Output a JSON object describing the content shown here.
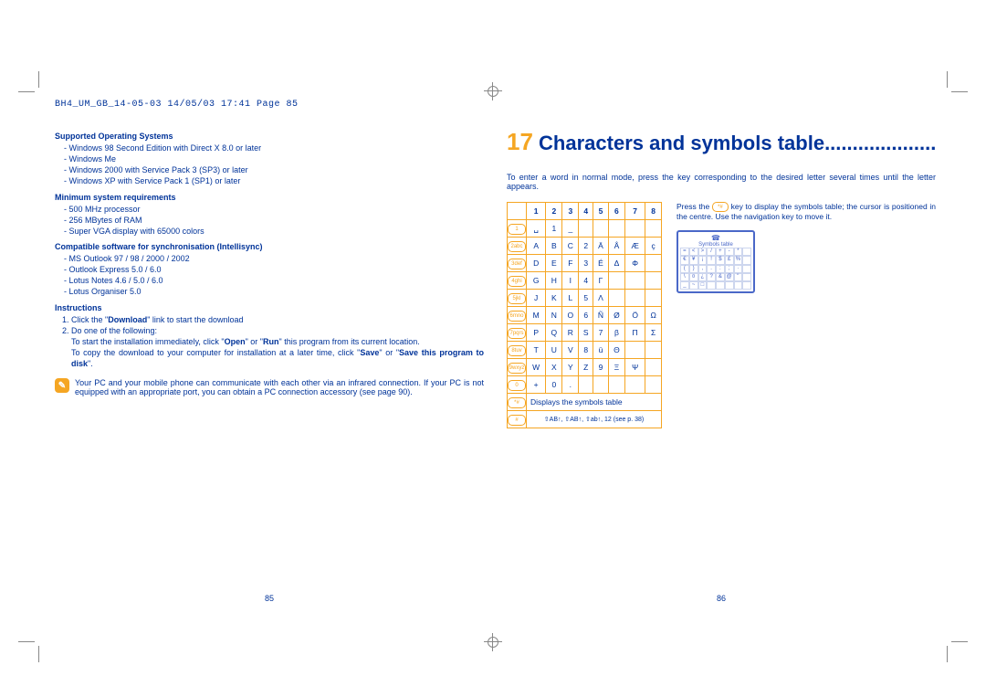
{
  "header_strip": "BH4_UM_GB_14-05-03  14/05/03  17:41  Page 85",
  "left": {
    "h_os": "Supported Operating Systems",
    "os": [
      "Windows 98 Second Edition with Direct X 8.0 or later",
      "Windows Me",
      "Windows 2000 with Service Pack 3 (SP3) or later",
      "Windows XP with Service Pack 1 (SP1) or later"
    ],
    "h_req": "Minimum system requirements",
    "req": [
      "500 MHz processor",
      "256 MBytes of RAM",
      "Super VGA display with 65000 colors"
    ],
    "h_sw": "Compatible software for synchronisation (Intellisync)",
    "sw": [
      "MS Outlook 97 / 98 / 2000 / 2002",
      "Outlook Express 5.0 / 6.0",
      "Lotus Notes 4.6 / 5.0 / 6.0",
      "Lotus Organiser 5.0"
    ],
    "h_inst": "Instructions",
    "inst1_a": "Click the \"",
    "inst1_b": "Download",
    "inst1_c": "\" link to start the download",
    "inst2": "Do one of the following:",
    "inst_sub_a": "To start the installation immediately, click \"",
    "inst_sub_b": "Open",
    "inst_sub_c": "\" or \"",
    "inst_sub_d": "Run",
    "inst_sub_e": "\" this program from its current location.",
    "inst_sub2_a": "To copy the download to your computer for installation at a later time, click \"",
    "inst_sub2_b": "Save",
    "inst_sub2_c": "\" or \"",
    "inst_sub2_d": "Save this program to disk",
    "inst_sub2_e": "\".",
    "note": "Your PC and your mobile phone can communicate with each other via an infrared connection. If your PC is not equipped with an appropriate port, you can obtain a PC connection accessory (see page 90).",
    "pgnum": "85"
  },
  "right": {
    "chapter_num": "17",
    "chapter_title": "Characters and symbols table",
    "chapter_dots": "....................",
    "intro": "To enter a word in normal mode, press the key corresponding to the desired letter several times until the letter appears.",
    "side_a": "Press the ",
    "side_b": " key to display the symbols table; the cursor is positioned in the centre. Use the navigation key to move it.",
    "table": {
      "head": [
        "",
        "1",
        "2",
        "3",
        "4",
        "5",
        "6",
        "7",
        "8"
      ],
      "rows": [
        {
          "key": "1",
          "cells": [
            "␣",
            "1",
            "_",
            "",
            "",
            "",
            "",
            ""
          ]
        },
        {
          "key": "2abc",
          "cells": [
            "A",
            "B",
            "C",
            "2",
            "Ä",
            "Å",
            "Æ",
            "ç"
          ]
        },
        {
          "key": "3def",
          "cells": [
            "D",
            "E",
            "F",
            "3",
            "É",
            "Δ",
            "Φ",
            ""
          ]
        },
        {
          "key": "4ghi",
          "cells": [
            "G",
            "H",
            "I",
            "4",
            "Γ",
            "",
            "",
            ""
          ]
        },
        {
          "key": "5jkl",
          "cells": [
            "J",
            "K",
            "L",
            "5",
            "Λ",
            "",
            "",
            ""
          ]
        },
        {
          "key": "6mno",
          "cells": [
            "M",
            "N",
            "O",
            "6",
            "Ñ",
            "Ø",
            "Ö",
            "Ω"
          ]
        },
        {
          "key": "7pqrs",
          "cells": [
            "P",
            "Q",
            "R",
            "S",
            "7",
            "β",
            "Π",
            "Σ"
          ]
        },
        {
          "key": "8tuv",
          "cells": [
            "T",
            "U",
            "V",
            "8",
            "ü",
            "Θ",
            "",
            ""
          ]
        },
        {
          "key": "9wxyz",
          "cells": [
            "W",
            "X",
            "Y",
            "Z",
            "9",
            "Ξ",
            "Ψ",
            ""
          ]
        },
        {
          "key": "0",
          "cells": [
            "+",
            "0",
            ".",
            "",
            "",
            "",
            "",
            ""
          ]
        }
      ],
      "display_row_key": "*#",
      "display_row": "Displays the symbols table",
      "footer_key": "#",
      "footer": "⇧AB↑, ⇧AB↑, ⇧ab↑, 12  (see p. 38)"
    },
    "screen": {
      "title": "Symbols table",
      "cells": [
        "=",
        "<",
        ">",
        "/",
        "+",
        "-",
        "*",
        "",
        "€",
        "¥",
        "¡",
        "!",
        "$",
        "£",
        "%",
        "",
        "(",
        ")",
        ",",
        ".",
        ":",
        ";",
        "·",
        "",
        "\\",
        "¤",
        "¿",
        "?",
        "&",
        "@",
        "\"",
        "",
        "_",
        "~",
        "□",
        "",
        "",
        "",
        "",
        ""
      ]
    },
    "pgnum": "86"
  }
}
